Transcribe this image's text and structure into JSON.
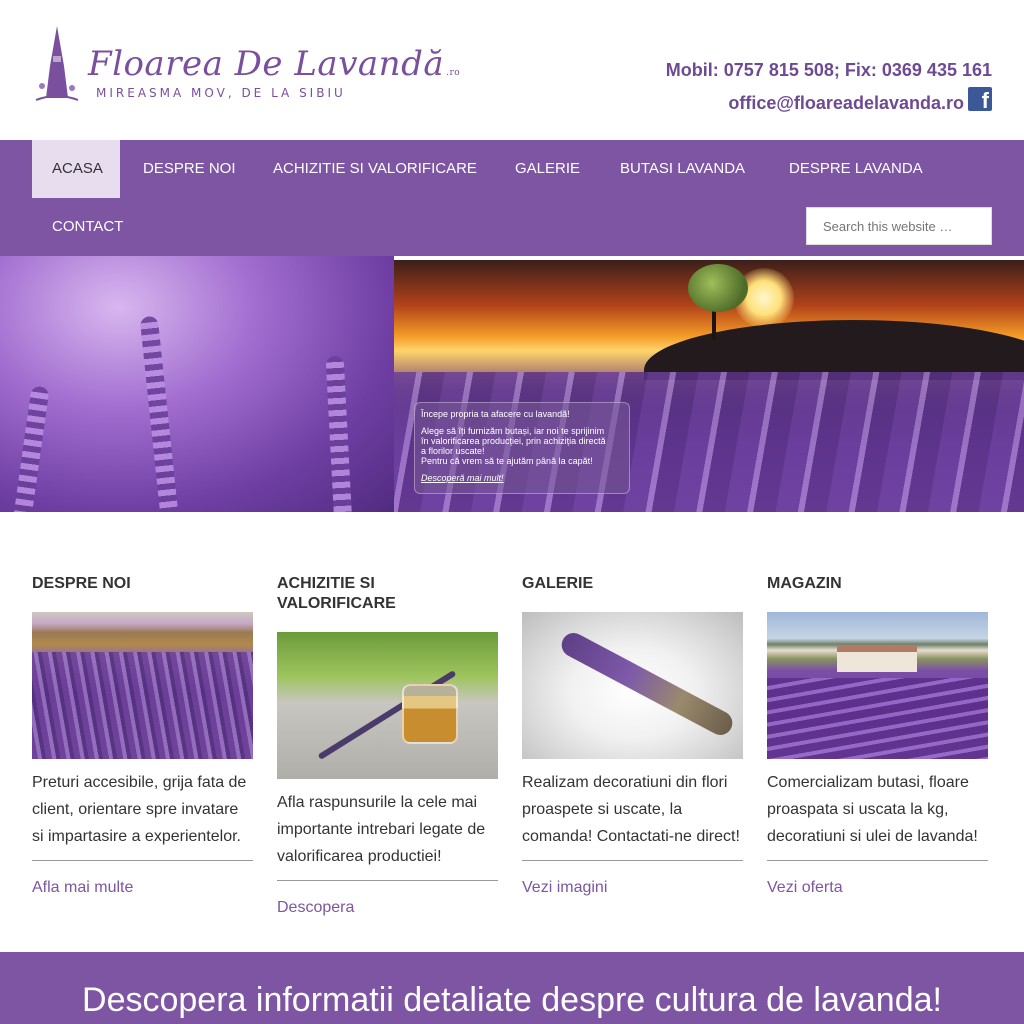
{
  "brand": {
    "name": "Floarea De Lavandă",
    "tld": ".ro",
    "tagline": "MIREASMA MOV, DE LA SIBIU"
  },
  "contact": {
    "phone": "Mobil: 0757 815 508; Fix: 0369 435 161",
    "email": "office@floareadelavanda.ro",
    "social_icon": "facebook-icon"
  },
  "nav": {
    "items": [
      {
        "label": "ACASA",
        "active": true
      },
      {
        "label": "DESPRE NOI"
      },
      {
        "label": "ACHIZITIE SI VALORIFICARE"
      },
      {
        "label": "GALERIE"
      },
      {
        "label": "BUTASI LAVANDA"
      },
      {
        "label": "DESPRE LAVANDA"
      },
      {
        "label": "CONTACT"
      }
    ],
    "search_placeholder": "Search this website …"
  },
  "hero": {
    "box_title": "Începe propria ta afacere cu lavandă!",
    "box_lines": [
      "Alege să îți furnizăm butași, iar noi te sprijinim",
      "în valorificarea producției, prin achiziția directă",
      "a florilor uscate!",
      "Pentru că vrem să te ajutăm până la capăt!"
    ],
    "box_link": "Descoperă mai mult!"
  },
  "columns": [
    {
      "title": "DESPRE NOI",
      "text": "Preturi accesibile, grija fata de client, orientare spre invatare si impartasire a experientelor.",
      "link": "Afla mai multe"
    },
    {
      "title": "ACHIZITIE SI VALORIFICARE",
      "text": "Afla raspunsurile la cele mai importante intrebari legate de valorificarea productiei!",
      "link": "Descopera"
    },
    {
      "title": "GALERIE",
      "text": "Realizam decoratiuni din flori proaspete si uscate, la comanda! Contactati-ne direct!",
      "link": "Vezi imagini"
    },
    {
      "title": "MAGAZIN",
      "text": "Comercializam butasi, floare proaspata si uscata la kg, decoratiuni si ulei de lavanda!",
      "link": "Vezi oferta"
    }
  ],
  "banner": {
    "text": "Descopera informatii detaliate despre cultura de lavanda!"
  },
  "colors": {
    "accent": "#7d55a3",
    "active_nav": "#e8dcef",
    "brand_text": "#6e4a93"
  }
}
